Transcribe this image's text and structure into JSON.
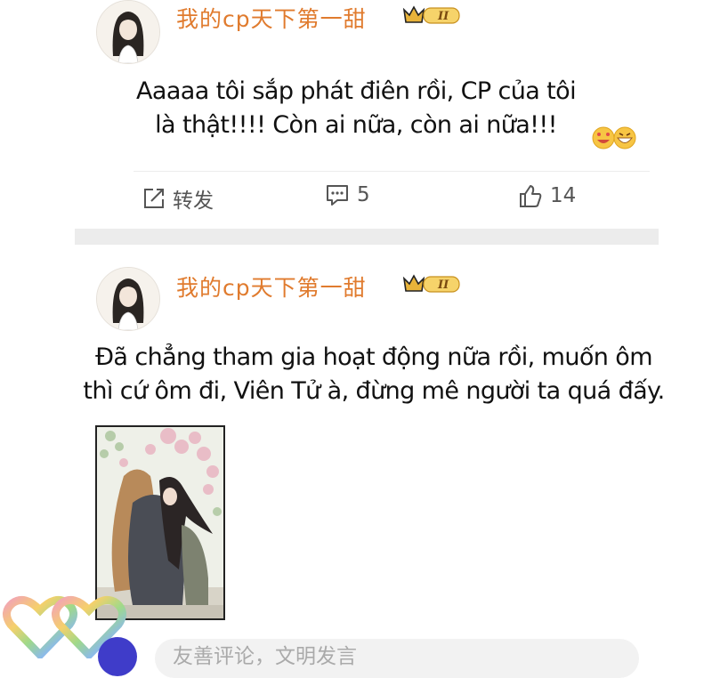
{
  "posts": [
    {
      "username": "我的cp天下第一甜",
      "badge": "II",
      "text_line1": "Aaaaa tôi sắp phát điên rồi, CP của tôi",
      "text_line2": "là thật!!!! Còn ai nữa, còn ai nữa!!!",
      "repost_label": "转发",
      "comment_count": "5",
      "like_count": "14"
    },
    {
      "username": "我的cp天下第一甜",
      "badge": "II",
      "text_line1": "Đã chẳng tham gia hoạt động nữa rồi, muốn ôm",
      "text_line2": "thì cứ ôm đi, Viên Tử à, đừng mê người ta quá đấy."
    }
  ],
  "comment_bar": {
    "placeholder": "友善评论，文明发言"
  },
  "colors": {
    "username": "#e07b2e",
    "badge_gold": "#e8b33a",
    "action_gray": "#555555"
  },
  "icons": [
    "repost-icon",
    "comment-icon",
    "like-icon",
    "crown-badge-icon",
    "emoji-icon",
    "rainbow-hearts-icon"
  ]
}
